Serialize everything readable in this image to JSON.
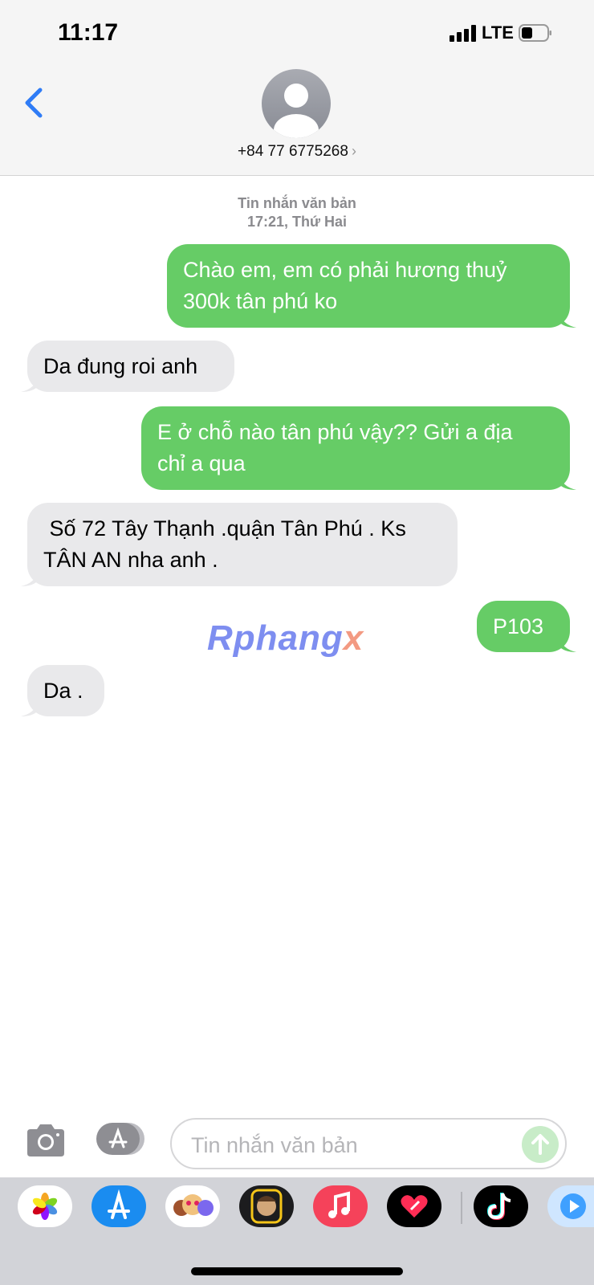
{
  "status_bar": {
    "time": "11:17",
    "network": "LTE"
  },
  "header": {
    "contact": "+84 77 6775268",
    "contact_chevron": "›"
  },
  "thread": {
    "type_label": "Tin nhắn văn bản",
    "timestamp": "17:21, Thứ Hai",
    "messages": [
      {
        "direction": "outgoing",
        "lines": [
          "Chào em, em có phải hương thuỷ",
          "300k tân phú ko"
        ]
      },
      {
        "direction": "incoming",
        "lines": [
          "Da đung roi anh"
        ]
      },
      {
        "direction": "outgoing",
        "lines": [
          "E ở chỗ nào tân phú vậy?? Gửi a địa",
          "chỉ a qua"
        ]
      },
      {
        "direction": "incoming",
        "lines": [
          " Số 72 Tây Thạnh .quận Tân Phú . Ks",
          "TÂN AN nha anh ."
        ]
      },
      {
        "direction": "outgoing",
        "lines": [
          "P103"
        ]
      },
      {
        "direction": "incoming",
        "lines": [
          "Da ."
        ]
      }
    ]
  },
  "watermark": {
    "main": "Rphang",
    "tail": "x"
  },
  "compose": {
    "placeholder": "Tin nhắn văn bản"
  },
  "app_tray": [
    "photos-icon",
    "app-store-icon",
    "animoji-icon",
    "memoji-icon",
    "music-icon",
    "heart-app-icon",
    "tiktok-icon",
    "clips-icon"
  ],
  "colors": {
    "outgoing": "#66cc66",
    "incoming": "#e9e9eb",
    "accent": "#2f7cf6"
  }
}
